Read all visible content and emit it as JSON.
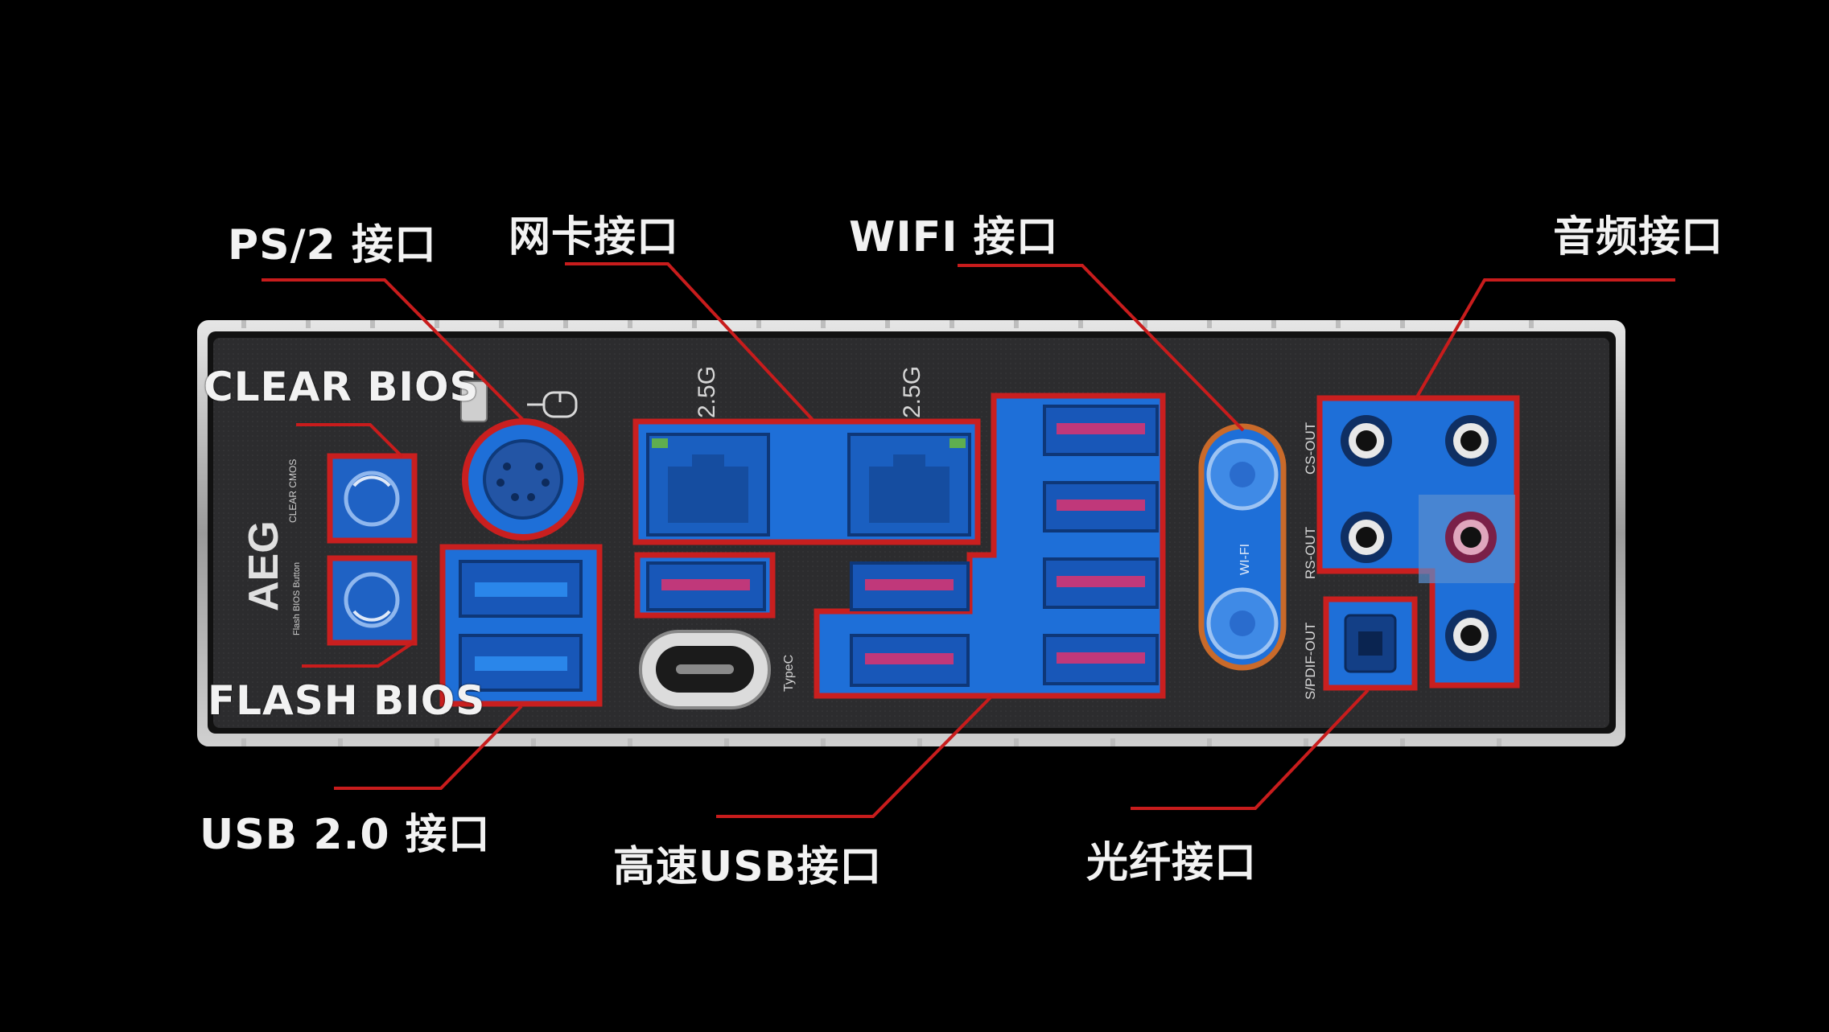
{
  "colors": {
    "background": "#000000",
    "plate": "#2a2a2c",
    "frame": "#d8d8d8",
    "highlight_fill": "#1e6fd8",
    "highlight_border": "#c91f1f",
    "leader_line": "#c81c1c",
    "label_text": "#f2f2f2"
  },
  "labels": {
    "ps2": "PS/2 接口",
    "network": "网卡接口",
    "wifi": "WIFI 接口",
    "audio": "音频接口",
    "clear_bios": "CLEAR  BIOS",
    "flash_bios": "FLASH BIOS",
    "usb2": "USB 2.0 接口",
    "high_speed_usb": "高速USB接口",
    "optical": "光纤接口"
  },
  "plate_text": {
    "lan_speed_left": "2.5G",
    "lan_speed_right": "2.5G",
    "aeg_logo": "AEG",
    "clear_cmos": "CLEAR CMOS",
    "flash_bios_button": "Flash BIOS Button",
    "type_c": "TypeC",
    "wifi_text": "WI-FI",
    "cs_out": "CS-OUT",
    "rs_out": "RS-OUT",
    "spdif_out": "S/PDIF-OUT"
  }
}
